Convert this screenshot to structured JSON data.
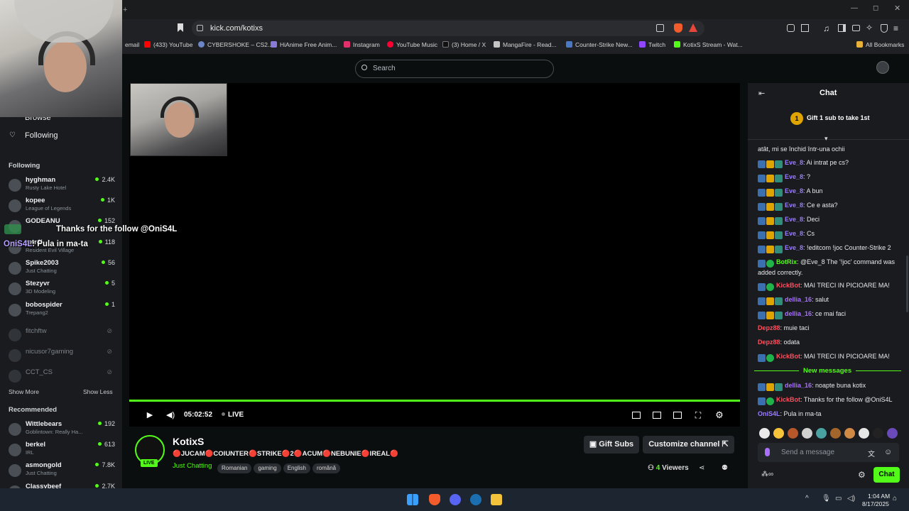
{
  "browser": {
    "url": "kick.com/kotixs",
    "bookmarks": [
      "email",
      "(433) YouTube",
      "CYBERSHOKE – CS2...",
      "HiAnime Free Anim...",
      "Instagram",
      "YouTube Music",
      "(3) Home / X",
      "MangaFire - Read...",
      "Counter-Strike New...",
      "Twitch",
      "KotixS Stream - Wat..."
    ],
    "all_bookmarks": "All Bookmarks"
  },
  "header": {
    "search_placeholder": "Search"
  },
  "sidebar": {
    "browse": "Browse",
    "following_nav": "Following",
    "following_heading": "Following",
    "following": [
      {
        "name": "hyghman",
        "game": "Rusty Lake Hotel",
        "viewers": "2.4K"
      },
      {
        "name": "kopee",
        "game": "League of Legends",
        "viewers": "1K"
      },
      {
        "name": "GODEANU",
        "game": "",
        "viewers": "152"
      },
      {
        "name": "retr4l",
        "game": "Resident Evil Village",
        "viewers": "118"
      },
      {
        "name": "Spike2003",
        "game": "Just Chatting",
        "viewers": "56"
      },
      {
        "name": "Stezyvr",
        "game": "3D Modeling",
        "viewers": "5"
      },
      {
        "name": "bobospider",
        "game": "Trepang2",
        "viewers": "1"
      },
      {
        "name": "fitchftw",
        "game": "",
        "viewers": ""
      },
      {
        "name": "nicusor7gaming",
        "game": "",
        "viewers": ""
      },
      {
        "name": "CCT_CS",
        "game": "",
        "viewers": ""
      }
    ],
    "show_more": "Show More",
    "show_less": "Show Less",
    "recommended_heading": "Recommended",
    "recommended": [
      {
        "name": "Wittlebears",
        "game": "Goblintown: Really Ha...",
        "viewers": "192"
      },
      {
        "name": "berkel",
        "game": "IRL",
        "viewers": "613"
      },
      {
        "name": "asmongold",
        "game": "Just Chatting",
        "viewers": "7.8K"
      },
      {
        "name": "Classybeef",
        "game": "",
        "viewers": "2.7K"
      }
    ]
  },
  "overlay": {
    "follow_alert": "Thanks for the follow @OniS4L",
    "chat_user": "OniS4L",
    "chat_text": ": Pula in ma-ta"
  },
  "player": {
    "time": "05:02:52",
    "live_label": "LIVE"
  },
  "stream": {
    "channel": "KotixS",
    "live_badge": "LIVE",
    "title": "🔴JUCAM🔴COIUNTER🔴STRIKE🔴2🔴ACUM🔴NEBUNIE🔴IREAL🔴",
    "category": "Just Chatting",
    "tags": [
      "Romanian",
      "gaming",
      "English",
      "română"
    ],
    "gift_subs": "Gift Subs",
    "customize": "Customize channel",
    "viewers": "4",
    "viewers_label": "Viewers"
  },
  "chat": {
    "title": "Chat",
    "gift_banner_count": "1",
    "gift_banner": "Gift 1 sub to take 1st",
    "truncated_top": "atât, mi se închid într-una ochii",
    "messages": [
      {
        "user": "Eve_8",
        "text": ": Ai intrat pe cs?",
        "color": "#9b7cff"
      },
      {
        "user": "Eve_8",
        "text": ": ?",
        "color": "#9b7cff"
      },
      {
        "user": "Eve_8",
        "text": ": A bun",
        "color": "#9b7cff"
      },
      {
        "user": "Eve_8",
        "text": ": Ce e asta?",
        "color": "#9b7cff"
      },
      {
        "user": "Eve_8",
        "text": ": Deci",
        "color": "#9b7cff"
      },
      {
        "user": "Eve_8",
        "text": ": Cs",
        "color": "#9b7cff"
      },
      {
        "user": "Eve_8",
        "text": ": !editcom !joc Counter-Strike 2",
        "color": "#9b7cff"
      },
      {
        "user": "BotRix",
        "text": ": @Eve_8 The '!joc' command was added correctly.",
        "color": "#53fc18"
      },
      {
        "user": "KickBot",
        "text": ": MAI TRECI IN PICIOARE MA!",
        "color": "#ff4f5e"
      },
      {
        "user": "dellia_16",
        "text": ": salut",
        "color": "#a970ff"
      },
      {
        "user": "dellia_16",
        "text": ": ce mai faci",
        "color": "#a970ff"
      },
      {
        "user": "Depz88",
        "text": ": muie taci",
        "color": "#ff4f5e"
      },
      {
        "user": "Depz88",
        "text": ": odata",
        "color": "#ff4f5e"
      },
      {
        "user": "KickBot",
        "text": ": MAI TRECI IN PICIOARE MA!",
        "color": "#ff4f5e"
      }
    ],
    "new_messages": "New messages",
    "new": [
      {
        "user": "dellia_16",
        "text": ": noapte buna kotix",
        "color": "#a970ff"
      },
      {
        "user": "KickBot",
        "text": ": Thanks for the follow @OniS4L",
        "color": "#ff4f5e"
      },
      {
        "user": "OniS4L",
        "text": ": Pula in ma-ta",
        "color": "#9b7cff"
      }
    ],
    "input_placeholder": "Send a message",
    "send": "Chat"
  },
  "taskbar": {
    "time": "1:04 AM",
    "date": "8/17/2025"
  }
}
